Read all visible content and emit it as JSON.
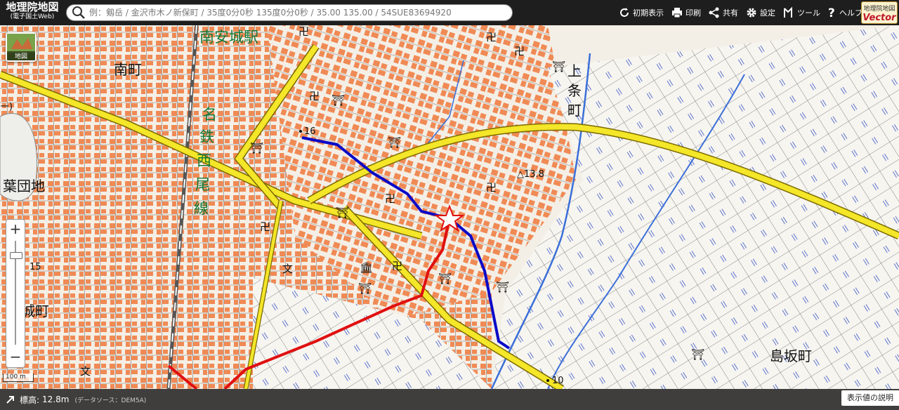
{
  "header": {
    "app_title": "地理院地図",
    "app_subtitle": "(電子国土Web)",
    "search_placeholder": "例：剱岳 / 金沢市木ノ新保町 / 35度0分0秒 135度0分0秒 / 35.00 135.00 / 54SUE83694920",
    "tools": [
      {
        "label": "初期表示",
        "icon": "refresh-icon"
      },
      {
        "label": "印刷",
        "icon": "printer-icon"
      },
      {
        "label": "共有",
        "icon": "share-icon"
      },
      {
        "label": "設定",
        "icon": "gear-icon"
      },
      {
        "label": "ツール",
        "icon": "tool-icon"
      },
      {
        "label": "ヘルプ",
        "icon": "help-icon"
      }
    ],
    "badge_line1": "地理院地図",
    "badge_line2": "Vector"
  },
  "map": {
    "basemap_button_label": "地図",
    "scale_label": "100 m",
    "zoom_in": "+",
    "zoom_out": "−",
    "labels": {
      "minami_machi": "南町",
      "minami_anjo_station": "南安城駅",
      "kamijo_1": "上",
      "kamijo_2": "条",
      "kamijo_3": "町",
      "rail_1": "名",
      "rail_2": "鉄",
      "rail_3": "西",
      "rail_4": "尾",
      "rail_5": "線",
      "hato_danchi": "葉団地",
      "shiro_machi": "城町",
      "shimasaka_machi": "島坂町",
      "elev_16": "16",
      "elev_15": "15",
      "elev_10": "10",
      "triangulation": "△13.8",
      "paren_fragment": "ー)"
    },
    "colors": {
      "road_yellow": "#f4e628",
      "route_blue": "#0a0ac8",
      "route_red": "#e01010",
      "building": "#f08a55",
      "water": "#3a6fd8",
      "background": "#f4efe6"
    }
  },
  "footer": {
    "elevation_label": "標高:",
    "elevation_value": "12.8m",
    "data_source": "(データソース：DEM5A)",
    "legend_button": "表示値の説明"
  }
}
